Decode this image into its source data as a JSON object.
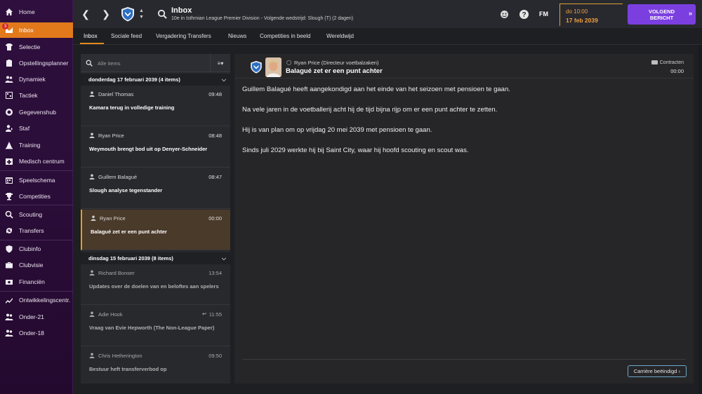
{
  "sidebar": {
    "items": [
      {
        "label": "Home",
        "icon": "home-icon"
      },
      {
        "label": "Inbox",
        "icon": "inbox-icon",
        "active": true,
        "badge": "3"
      },
      {
        "label": "Selectie",
        "icon": "shirt-icon"
      },
      {
        "label": "Opstellingsplanner",
        "icon": "clipboard-icon"
      },
      {
        "label": "Dynamiek",
        "icon": "people-icon"
      },
      {
        "label": "Tactiek",
        "icon": "board-icon"
      },
      {
        "label": "Gegevenshub",
        "icon": "data-icon"
      },
      {
        "label": "Staf",
        "icon": "staff-icon"
      },
      {
        "label": "Training",
        "icon": "cone-icon"
      },
      {
        "label": "Medisch centrum",
        "icon": "medical-icon"
      },
      {
        "label": "Speelschema",
        "icon": "calendar-icon"
      },
      {
        "label": "Competities",
        "icon": "trophy-icon"
      },
      {
        "label": "Scouting",
        "icon": "magnifier-icon"
      },
      {
        "label": "Transfers",
        "icon": "transfer-icon"
      },
      {
        "label": "Clubinfo",
        "icon": "shield-icon"
      },
      {
        "label": "Clubvisie",
        "icon": "briefcase-icon"
      },
      {
        "label": "Financiën",
        "icon": "finance-icon"
      },
      {
        "label": "Ontwikkelingscentr.",
        "icon": "development-icon"
      },
      {
        "label": "Onder-21",
        "icon": "youth-icon"
      },
      {
        "label": "Onder-18",
        "icon": "youth-icon"
      }
    ]
  },
  "topbar": {
    "title": "Inbox",
    "subtitle": "10e in Isthmian League Premier Division - Volgende wedstrijd: Slough (T) (2 dagen)",
    "fm_logo": "FM",
    "time": "do 10:00",
    "date": "17 feb 2039",
    "next_button": "VOLGEND BERICHT",
    "accent": "#7b3fe0"
  },
  "tabs": [
    "Inbox",
    "Sociale feed",
    "Vergadering Transfers",
    "Nieuws",
    "Competities in beeld",
    "Wereldwijd"
  ],
  "list": {
    "search_placeholder": "Alle items",
    "groups": [
      {
        "header": "donderdag 17 februari 2039 (4 items)",
        "messages": [
          {
            "sender": "Daniel Thomas",
            "time": "09:48",
            "subject": "Kamara terug in volledige training"
          },
          {
            "sender": "Ryan Price",
            "time": "08:48",
            "subject": "Weymouth brengt bod uit op Denyer-Schneider"
          },
          {
            "sender": "Guillem Balagué",
            "time": "08:47",
            "subject": "Slough analyse tegenstander"
          },
          {
            "sender": "Ryan Price",
            "time": "00:00",
            "subject": "Balagué zet er een punt achter",
            "selected": true
          }
        ]
      },
      {
        "header": "dinsdag 15 februari 2039 (8 items)",
        "messages": [
          {
            "sender": "Richard Bonser",
            "time": "13:54",
            "subject": "Updates over de doelen van en beloftes aan spelers"
          },
          {
            "sender": "Adie Hook",
            "time": "11:55",
            "subject": "Vraag van Evie Hepworth (The Non-League Paper)"
          },
          {
            "sender": "Chris Hetherington",
            "time": "09:50",
            "subject": "Bestuur heft transferverbod op"
          }
        ]
      }
    ]
  },
  "detail": {
    "from": "Ryan Price  (Directeur voetbalzaken)",
    "subject": "Balagué zet er een punt achter",
    "category": "Contracten",
    "time": "00:00",
    "paragraphs": [
      "Guillem Balagué heeft aangekondigd aan het einde van het seizoen met pensioen te gaan.",
      "Na vele jaren in de voetballerij acht hij de tijd bijna rijp om er een punt achter te zetten.",
      "Hij is van plan om op vrijdag 20 mei 2039 met pensioen te gaan.",
      "Sinds juli 2029 werkte hij bij Saint City, waar hij hoofd scouting en scout was."
    ],
    "action_button": "Carrière beëindigd"
  }
}
